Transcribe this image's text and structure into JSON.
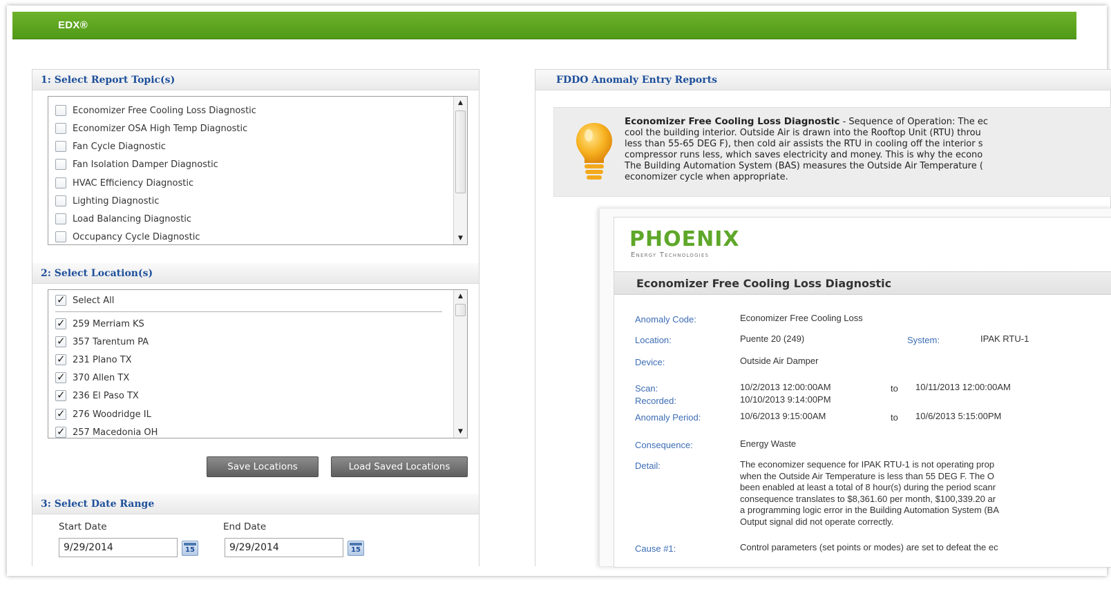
{
  "app": {
    "brand": "EDX®"
  },
  "left": {
    "topics": {
      "heading": "1: Select Report Topic(s)",
      "items": [
        {
          "label": "Economizer Free Cooling Loss Diagnostic",
          "checked": false
        },
        {
          "label": "Economizer OSA High Temp Diagnostic",
          "checked": false
        },
        {
          "label": "Fan Cycle Diagnostic",
          "checked": false
        },
        {
          "label": "Fan Isolation Damper Diagnostic",
          "checked": false
        },
        {
          "label": "HVAC Efficiency Diagnostic",
          "checked": false
        },
        {
          "label": "Lighting Diagnostic",
          "checked": false
        },
        {
          "label": "Load Balancing Diagnostic",
          "checked": false
        },
        {
          "label": "Occupancy Cycle Diagnostic",
          "checked": false
        }
      ]
    },
    "locations": {
      "heading": "2: Select Location(s)",
      "select_all": "Select All",
      "items": [
        {
          "label": "259 Merriam KS",
          "checked": true
        },
        {
          "label": "357 Tarentum PA",
          "checked": true
        },
        {
          "label": "231 Plano TX",
          "checked": true
        },
        {
          "label": "370 Allen TX",
          "checked": true
        },
        {
          "label": "236 El Paso TX",
          "checked": true
        },
        {
          "label": "276 Woodridge IL",
          "checked": true
        },
        {
          "label": "257 Macedonia OH",
          "checked": true
        }
      ],
      "save_button": "Save Locations",
      "load_button": "Load Saved Locations"
    },
    "dates": {
      "heading": "3: Select Date Range",
      "start_label": "Start Date",
      "start_value": "9/29/2014",
      "end_label": "End Date",
      "end_value": "9/29/2014",
      "calendar_icon_text": "15"
    }
  },
  "right": {
    "heading": "FDDO Anomaly Entry Reports",
    "info": {
      "title": "Economizer Free Cooling Loss Diagnostic",
      "lines": [
        " - Sequence of Operation: The ec",
        "cool the building interior. Outside Air is drawn into the Rooftop Unit (RTU) throu",
        "less than 55-65 DEG F), then cold air assists the RTU in cooling off the interior s",
        "compressor runs less, which saves electricity and money. This is why the econo",
        "The Building Automation System (BAS) measures the Outside Air Temperature (",
        "economizer cycle when appropriate."
      ]
    },
    "report": {
      "logo_main": "PHOENIX",
      "logo_sub": "Energy Technologies",
      "title": "Economizer Free Cooling Loss Diagnostic",
      "anomaly_code_label": "Anomaly Code:",
      "anomaly_code": "Economizer Free Cooling Loss",
      "location_label": "Location:",
      "location": "Puente 20 (249)",
      "system_label": "System:",
      "system": "IPAK RTU-1",
      "device_label": "Device:",
      "device": "Outside Air Damper",
      "scan_label": "Scan:",
      "scan_from": "10/2/2013  12:00:00AM",
      "to_word": "to",
      "scan_to": "10/11/2013  12:00:00AM",
      "recorded_label": "Recorded:",
      "recorded": "10/10/2013  9:14:00PM",
      "period_label": "Anomaly Period:",
      "period_from": "10/6/2013  9:15:00AM",
      "period_to": "10/6/2013  5:15:00PM",
      "consequence_label": "Consequence:",
      "consequence": "Energy Waste",
      "detail_label": "Detail:",
      "detail_lines": [
        "The economizer sequence for IPAK RTU-1 is not operating prop",
        "when the Outside Air Temperature is less than 55 DEG F. The O",
        "been enabled at least a total of 8 hour(s) during the period scanr",
        "consequence translates to $8,361.60 per month, $100,339.20 ar",
        "a programming logic error in the Building Automation System (BA",
        "Output signal did not operate correctly."
      ],
      "cause_label": "Cause #1:",
      "cause": "Control parameters (set points or modes) are set to defeat the ec"
    }
  },
  "colors": {
    "brand_green": "#5ea72a",
    "heading_blue": "#1d4f9a",
    "label_blue": "#3c6cb4"
  }
}
